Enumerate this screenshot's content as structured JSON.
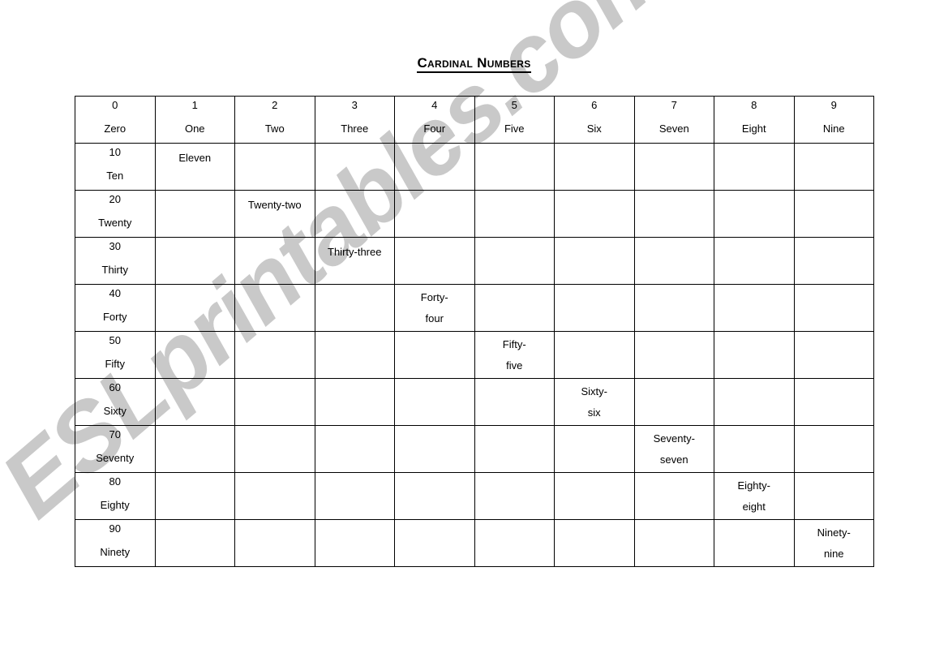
{
  "document": {
    "title": "Cardinal Numbers",
    "title_display": "Cardinal Numbers"
  },
  "watermark": {
    "text": "ESLprintables.com",
    "color": "#c9c9c9"
  },
  "table": {
    "columns": [
      {
        "digit": "0",
        "word": "Zero"
      },
      {
        "digit": "1",
        "word": "One"
      },
      {
        "digit": "2",
        "word": "Two"
      },
      {
        "digit": "3",
        "word": "Three"
      },
      {
        "digit": "4",
        "word": "Four"
      },
      {
        "digit": "5",
        "word": "Five"
      },
      {
        "digit": "6",
        "word": "Six"
      },
      {
        "digit": "7",
        "word": "Seven"
      },
      {
        "digit": "8",
        "word": "Eight"
      },
      {
        "digit": "9",
        "word": "Nine"
      }
    ],
    "rows": [
      {
        "number": "10",
        "word": "Ten",
        "cells": [
          "",
          "Eleven",
          "",
          "",
          "",
          "",
          "",
          "",
          "",
          ""
        ]
      },
      {
        "number": "20",
        "word": "Twenty",
        "cells": [
          "",
          "",
          "Twenty-two",
          "",
          "",
          "",
          "",
          "",
          "",
          ""
        ]
      },
      {
        "number": "30",
        "word": "Thirty",
        "cells": [
          "",
          "",
          "",
          "Thirty-three",
          "",
          "",
          "",
          "",
          "",
          ""
        ]
      },
      {
        "number": "40",
        "word": "Forty",
        "cells": [
          "",
          "",
          "",
          "",
          "Forty-four",
          "",
          "",
          "",
          "",
          ""
        ]
      },
      {
        "number": "50",
        "word": "Fifty",
        "cells": [
          "",
          "",
          "",
          "",
          "",
          "Fifty-five",
          "",
          "",
          "",
          ""
        ]
      },
      {
        "number": "60",
        "word": "Sixty",
        "cells": [
          "",
          "",
          "",
          "",
          "",
          "",
          "Sixty-six",
          "",
          "",
          ""
        ]
      },
      {
        "number": "70",
        "word": "Seventy",
        "cells": [
          "",
          "",
          "",
          "",
          "",
          "",
          "",
          "Seventy-seven",
          "",
          ""
        ]
      },
      {
        "number": "80",
        "word": "Eighty",
        "cells": [
          "",
          "",
          "",
          "",
          "",
          "",
          "",
          "",
          "Eighty-eight",
          ""
        ]
      },
      {
        "number": "90",
        "word": "Ninety",
        "cells": [
          "",
          "",
          "",
          "",
          "",
          "",
          "",
          "",
          "",
          "Ninety-nine"
        ]
      }
    ]
  }
}
